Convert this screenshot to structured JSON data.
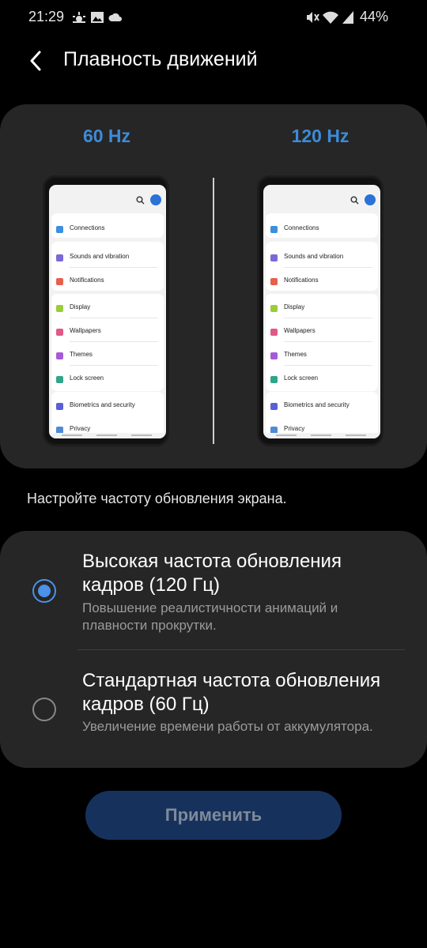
{
  "status_bar": {
    "time": "21:29",
    "battery": "44%",
    "left_icons": [
      "weather-sunrise-icon",
      "gallery-icon",
      "cloud-icon"
    ],
    "right_icons": [
      "mute-icon",
      "wifi-icon",
      "signal-icon"
    ]
  },
  "header": {
    "title": "Плавность движений",
    "back_icon": "back-arrow-icon"
  },
  "preview": {
    "left_label": "60 Hz",
    "right_label": "120 Hz",
    "settings_items": [
      {
        "label": "Connections",
        "color": "#3b8fdc"
      },
      {
        "label": "Sounds and vibration",
        "color": "#7b68d6"
      },
      {
        "label": "Notifications",
        "color": "#e8604c"
      },
      {
        "label": "Display",
        "color": "#9ccc3a"
      },
      {
        "label": "Wallpapers",
        "color": "#e05a87"
      },
      {
        "label": "Themes",
        "color": "#a55bd8"
      },
      {
        "label": "Lock screen",
        "color": "#2fa58a"
      },
      {
        "label": "Biometrics and security",
        "color": "#5a5fd8"
      },
      {
        "label": "Privacy",
        "color": "#4f8ad6"
      }
    ]
  },
  "description": "Настройте частоту обновления экрана.",
  "options": [
    {
      "title": "Высокая частота обновления кадров (120 Гц)",
      "subtitle": "Повышение реалистичности анимаций и плавности прокрутки.",
      "selected": true
    },
    {
      "title": "Стандартная частота обновления кадров (60 Гц)",
      "subtitle": "Увеличение времени работы от аккумулятора.",
      "selected": false
    }
  ],
  "apply_button": "Применить",
  "colors": {
    "accent": "#4b92e8",
    "hz_label": "#3d8bd9",
    "card_bg": "#262626",
    "button_bg": "#16325c"
  }
}
